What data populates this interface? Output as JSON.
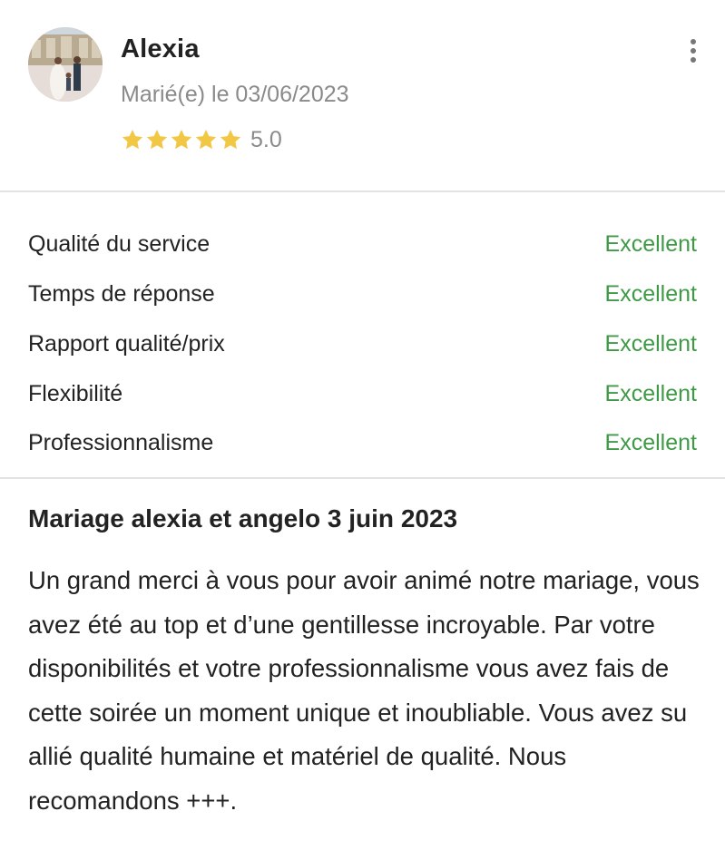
{
  "review": {
    "author": "Alexia",
    "married_date": "Marié(e) le 03/06/2023",
    "rating": 5.0,
    "rating_label": "5.0",
    "stars_filled": 5,
    "stars_total": 5,
    "icons": {
      "avatar": "avatar-photo",
      "more": "more-vertical-icon",
      "star": "star-icon"
    },
    "colors": {
      "star": "#f2c744",
      "excellent": "#3f9a45",
      "muted": "#8a8a8a"
    }
  },
  "criteria": [
    {
      "label": "Qualité du service",
      "value": "Excellent"
    },
    {
      "label": "Temps de réponse",
      "value": "Excellent"
    },
    {
      "label": "Rapport qualité/prix",
      "value": "Excellent"
    },
    {
      "label": "Flexibilité",
      "value": "Excellent"
    },
    {
      "label": "Professionnalisme",
      "value": "Excellent"
    }
  ],
  "body": {
    "title": "Mariage alexia et angelo 3 juin 2023",
    "text": "Un grand merci à vous pour avoir animé notre mariage, vous avez été au top et d’une gentillesse incroyable. Par votre disponibilités et votre professionnalisme vous avez fais de cette soirée un moment unique et inoubliable. Vous avez su allié qualité humaine et matériel de qualité. Nous recomandons +++."
  }
}
